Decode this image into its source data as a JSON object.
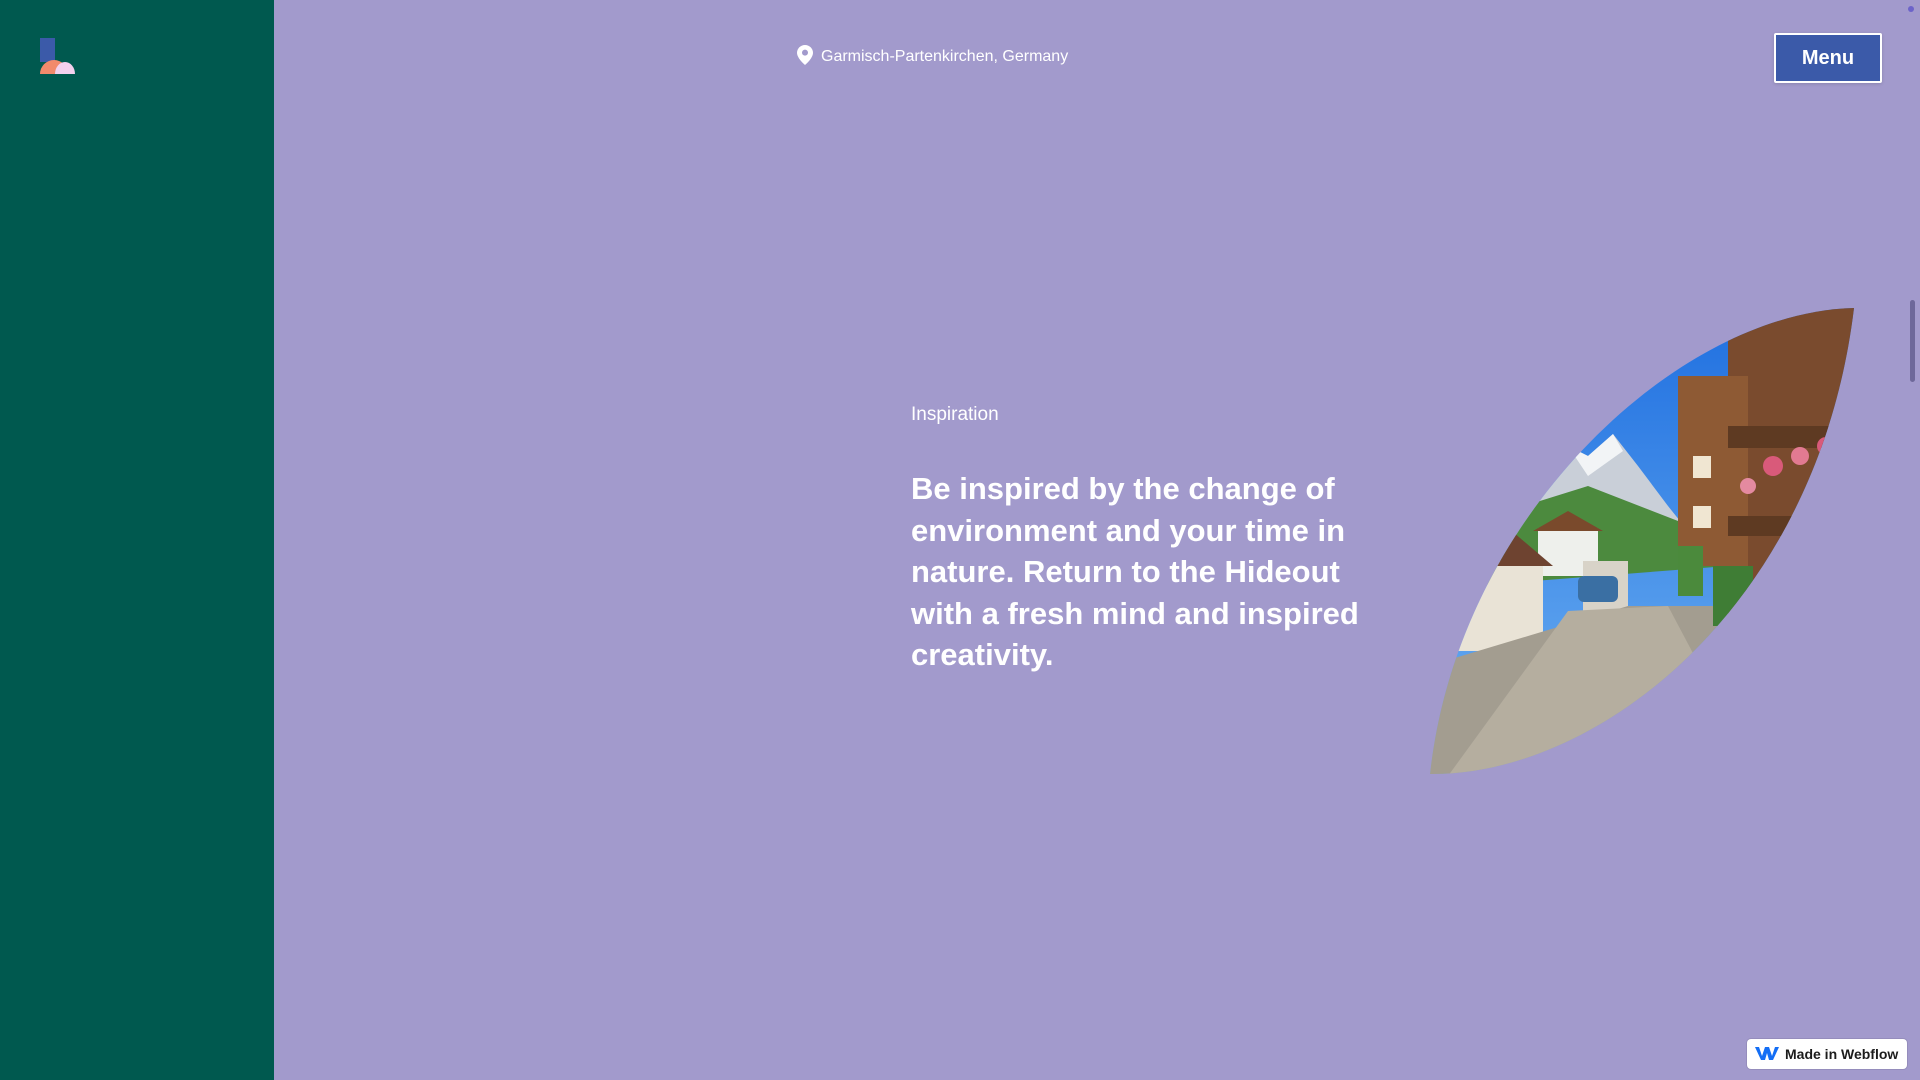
{
  "colors": {
    "page_bg": "#a29acc",
    "sidebar_bg": "#00594f",
    "menu_button_bg": "#3b5aa9",
    "text": "#ffffff",
    "webflow_blue": "#146ef5"
  },
  "header": {
    "logo_icon": "hideout-logo-icon",
    "location_icon": "map-pin-icon",
    "location": "Garmisch-Partenkirchen, Germany",
    "menu_label": "Menu"
  },
  "section": {
    "eyebrow": "Inspiration",
    "headline": "Be inspired by the change of environment and your time in nature. Return to the Hideout with a fresh mind and inspired creativity.",
    "image_subject": "alpine village street with chalets and mountain"
  },
  "badge": {
    "icon": "webflow-logo-icon",
    "label": "Made in Webflow"
  }
}
